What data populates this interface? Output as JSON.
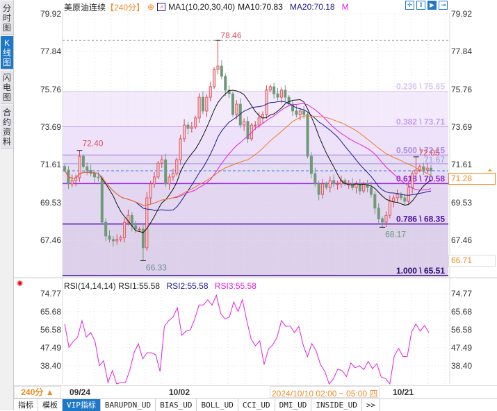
{
  "sidebar": {
    "tabs": [
      {
        "label": "分时图",
        "active": false
      },
      {
        "label": "K线图",
        "active": true
      },
      {
        "label": "闪电图",
        "active": false
      },
      {
        "label": "合约资料",
        "active": false
      }
    ]
  },
  "header": {
    "symbol": "美原油连续",
    "period": "【240分】",
    "ma_title": "MA1(10,20,30,40)",
    "ma10": "MA10:70.83",
    "ma20": "MA20:70.18",
    "ma_trunc": "M"
  },
  "toolbar": {
    "icons": [
      "crosshair-icon",
      "fit-range-icon",
      "play-icon",
      "exit-icon"
    ]
  },
  "price_axis": {
    "left": [
      "79.92",
      "77.84",
      "75.76",
      "73.69",
      "71.61",
      "69.53",
      "67.46"
    ],
    "right": [
      "79.92",
      "77.84",
      "75.76",
      "73.69",
      "71.61",
      "69.53",
      "67.46"
    ],
    "current": "71.28",
    "low_tag": "66.71"
  },
  "fib": [
    {
      "label": "0.236 \\ 75.65",
      "price": 75.65
    },
    {
      "label": "0.382 \\ 73.71",
      "price": 73.71
    },
    {
      "label": "0.500 \\ 72.15",
      "price": 72.15
    },
    {
      "label": "0.618 \\ 70.58",
      "price": 70.58
    },
    {
      "label": "0.786 \\ 68.35",
      "price": 68.35
    },
    {
      "label": "1.000 \\ 65.51",
      "price": 65.51
    }
  ],
  "annotations": {
    "high_left": "72.40",
    "low_left": "66.33",
    "peak": "78.46",
    "low_right": "68.17",
    "last_high": "72.05",
    "line_label": "71.67"
  },
  "colors": {
    "up": "#d9434f",
    "down": "#6f9a78",
    "ma10": "#111111",
    "ma20": "#1a1a8c",
    "ma30": "#e020e0",
    "ma40": "#f07820",
    "accent": "#1e78c8",
    "orange": "#f08a24"
  },
  "chart_data": {
    "type": "candlestick",
    "ylim": [
      65.51,
      79.92
    ],
    "closes": [
      71.32,
      70.56,
      70.75,
      70.9,
      72.08,
      71.51,
      71.3,
      71.13,
      70.94,
      70.9,
      68.45,
      67.69,
      67.5,
      67.42,
      67.5,
      67.6,
      68.45,
      68.83,
      68.26,
      68.07,
      68.07,
      67.04,
      69.79,
      70.56,
      70.94,
      71.7,
      71.89,
      70.56,
      70.94,
      71.13,
      71.89,
      73.04,
      73.8,
      73.61,
      73.69,
      74.19,
      75.33,
      74.57,
      75.33,
      75.91,
      76.86,
      77.05,
      76.48,
      75.72,
      75.52,
      74.38,
      74.95,
      73.8,
      74.0,
      73.04,
      73.8,
      73.8,
      74.19,
      74.38,
      75.72,
      75.91,
      75.52,
      75.33,
      75.72,
      75.33,
      74.95,
      74.57,
      74.38,
      74.57,
      74.38,
      72.08,
      71.13,
      70.56,
      69.98,
      70.56,
      70.36,
      70.75,
      70.56,
      70.56,
      70.75,
      70.56,
      70.56,
      70.36,
      70.56,
      70.17,
      70.56,
      70.36,
      69.98,
      69.22,
      68.64,
      68.45,
      68.83,
      69.6,
      69.79,
      69.98,
      69.79,
      69.6,
      70.36,
      71.13,
      71.32,
      71.51,
      71.32,
      71.43,
      71.28
    ],
    "extremes": [
      {
        "index": 4,
        "high": 72.4
      },
      {
        "index": 21,
        "low": 66.33
      },
      {
        "index": 41,
        "high": 78.46
      },
      {
        "index": 85,
        "low": 68.17
      },
      {
        "index": 94,
        "high": 72.05
      }
    ]
  },
  "rsi": {
    "title": "RSI(14,14,14)",
    "rsi1": "RSI1:55.58",
    "rsi2": "RSI2:55.58",
    "rsi3": "RSI3:55.58",
    "axis": [
      "74.77",
      "65.68",
      "56.58",
      "47.49",
      "38.40"
    ],
    "ylim": [
      29,
      76
    ],
    "values": [
      59.5,
      47.8,
      50.7,
      52.9,
      61.2,
      52.9,
      55.2,
      50.9,
      38.5,
      41,
      30,
      36,
      29,
      30,
      30,
      36,
      45,
      49.6,
      42,
      45,
      45,
      44,
      35.6,
      58.3,
      61.2,
      63,
      67.7,
      53.8,
      55.9,
      56.6,
      62,
      69.1,
      69.1,
      71.7,
      69,
      74,
      64.7,
      62,
      63,
      70.6,
      65.8,
      71.7,
      61.2,
      52,
      48.5,
      51,
      39.1,
      46.8,
      49,
      52.9,
      61.2,
      58.3,
      58.5,
      55.2,
      58.3,
      49,
      43,
      49.6,
      46,
      39,
      35.6,
      29,
      32,
      36.8,
      36,
      33,
      39.9,
      37.4,
      38.5,
      36.5,
      40.7,
      37,
      39.5,
      32.8,
      32,
      29,
      43.2,
      47.3,
      43.2,
      43,
      55.4,
      59.5,
      55.9,
      58.8,
      55.2
    ]
  },
  "xaxis": {
    "period_btn": "240分 ▲",
    "dates": [
      "09/24",
      "10/02",
      "10/21"
    ],
    "crosshair": "2024/10/10 02:00 ~ 05:00 四"
  },
  "bottom_tabs": [
    "指标",
    "模板",
    "VIP指标",
    "BARUPDN_UD",
    "BIAS_UD",
    "BOLL_UD",
    "CCI_UD",
    "DMI_UD",
    "INSIDE_UD",
    ">>"
  ]
}
